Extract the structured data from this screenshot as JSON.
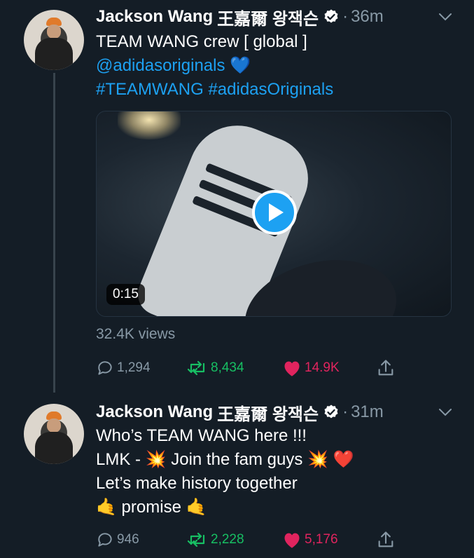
{
  "colors": {
    "background": "#141d26",
    "link": "#1da1f2",
    "muted": "#8899a6",
    "retweet": "#17bf63",
    "like": "#e0245e",
    "thread_line": "#38444d"
  },
  "tweets": [
    {
      "author_name": "Jackson Wang",
      "author_cjk": "王嘉爾 왕잭슨",
      "verified": true,
      "time_sep": "·",
      "time": "36m",
      "lines": [
        "TEAM WANG crew [ global ]"
      ],
      "mention": "@adidasoriginals",
      "mention_emoji": "💙",
      "hashtags": "#TEAMWANG #adidasOriginals",
      "video_duration": "0:15",
      "views": "32.4K views",
      "replies": "1,294",
      "retweets": "8,434",
      "likes": "14.9K",
      "icons": [
        "reply-icon",
        "retweet-icon",
        "heart-icon",
        "share-icon"
      ]
    },
    {
      "author_name": "Jackson Wang",
      "author_cjk": "王嘉爾 왕잭슨",
      "verified": true,
      "time_sep": "·",
      "time": "31m",
      "lines": [
        "Who’s TEAM WANG here !!!",
        "LMK - 💥 Join the fam guys 💥 ❤️",
        "Let’s make history together",
        "🤙 promise 🤙"
      ],
      "replies": "946",
      "retweets": "2,228",
      "likes": "5,176",
      "icons": [
        "reply-icon",
        "retweet-icon",
        "heart-icon",
        "share-icon"
      ]
    }
  ]
}
